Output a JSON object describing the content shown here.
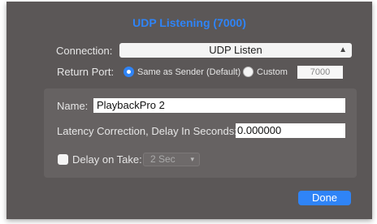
{
  "dialog": {
    "title": "UDP Listening (7000)",
    "connection_label": "Connection:",
    "connection_value": "UDP Listen",
    "return_port_label": "Return Port:",
    "same_as_sender_label": "Same as Sender (Default)",
    "custom_label": "Custom",
    "custom_port_value": "7000",
    "selected_return_port": "same_as_sender",
    "name_label": "Name:",
    "name_value": "PlaybackPro 2",
    "latency_label": "Latency Correction, Delay In Seconds:",
    "latency_value": "0.000000",
    "delay_on_take_label": "Delay on Take:",
    "delay_on_take_checked": false,
    "delay_value": "2 Sec",
    "done_label": "Done"
  },
  "colors": {
    "accent": "#2f84f7",
    "dialog_bg": "#5b5757",
    "group_bg": "#666262"
  }
}
